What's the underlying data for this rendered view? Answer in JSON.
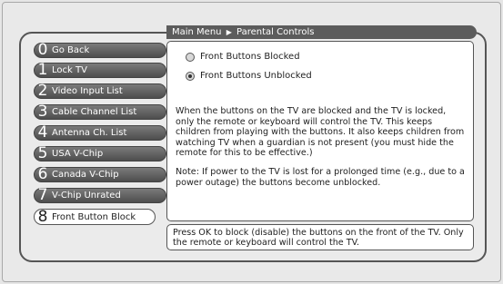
{
  "breadcrumb": {
    "parent": "Main Menu",
    "current": "Parental Controls"
  },
  "menu": [
    {
      "num": "0",
      "label": "Go Back"
    },
    {
      "num": "1",
      "label": "Lock TV"
    },
    {
      "num": "2",
      "label": "Video Input List"
    },
    {
      "num": "3",
      "label": "Cable Channel List"
    },
    {
      "num": "4",
      "label": "Antenna Ch. List"
    },
    {
      "num": "5",
      "label": "USA V-Chip"
    },
    {
      "num": "6",
      "label": "Canada V-Chip"
    },
    {
      "num": "7",
      "label": "V-Chip Unrated"
    },
    {
      "num": "8",
      "label": "Front Button Block"
    }
  ],
  "options": [
    {
      "label": "Front Buttons Blocked",
      "selected": false
    },
    {
      "label": "Front Buttons Unblocked",
      "selected": true
    }
  ],
  "description": [
    "When the buttons on the TV are blocked and the TV is locked, only the remote or keyboard will control the TV. This keeps children from playing with the buttons. It also keeps children from watching TV when a guardian is not present (you must hide the remote for this to be effective.)",
    "Note: If power to the TV is lost for a prolonged time (e.g., due to a power outage) the buttons become unblocked."
  ],
  "help_text": "Press OK to block (disable) the buttons on the front of the TV. Only the remote or keyboard will control the TV."
}
